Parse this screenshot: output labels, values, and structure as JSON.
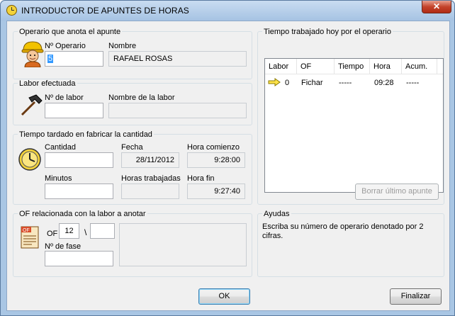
{
  "window": {
    "title": "INTRODUCTOR DE APUNTES DE HORAS",
    "close_glyph": "✕"
  },
  "operario": {
    "legend": "Operario que anota el apunte",
    "num_label": "Nº Operario",
    "num_value": "5",
    "nombre_label": "Nombre",
    "nombre_value": "RAFAEL ROSAS"
  },
  "labor": {
    "legend": "Labor efectuada",
    "num_label": "Nº de labor",
    "num_value": "",
    "nombre_label": "Nombre de la labor",
    "nombre_value": ""
  },
  "tiempo": {
    "legend": "Tiempo tardado en fabricar la cantidad",
    "cantidad_label": "Cantidad",
    "cantidad_value": "",
    "fecha_label": "Fecha",
    "fecha_value": "28/11/2012",
    "hora_comienzo_label": "Hora comienzo",
    "hora_comienzo_value": "9:28:00",
    "minutos_label": "Minutos",
    "minutos_value": "",
    "horas_trab_label": "Horas trabajadas",
    "horas_trab_value": "",
    "hora_fin_label": "Hora fin",
    "hora_fin_value": "9:27:40"
  },
  "of": {
    "legend": "OF relacionada con la labor a anotar",
    "of_label": "OF",
    "of_value": "12",
    "separator": "\\",
    "of_value2": "",
    "fase_label": "Nº de fase",
    "fase_value": "",
    "icon_text": "OF"
  },
  "trabajado": {
    "legend": "Tiempo trabajado hoy por el operario",
    "columns": [
      "Labor",
      "OF",
      "Tiempo",
      "Hora",
      "Acum."
    ],
    "rows": [
      {
        "labor": "0",
        "of": "Fichar",
        "tiempo": "-----",
        "hora": "09:28",
        "acum": "-----"
      }
    ],
    "borrar_label": "Borrar último apunte"
  },
  "ayudas": {
    "legend": "Ayudas",
    "text": "Escriba su número de operario denotado por 2 cifras."
  },
  "buttons": {
    "ok": "OK",
    "finalizar": "Finalizar"
  },
  "colors": {
    "accent": "#3399ff",
    "title_bg": "#a9c6e4",
    "close_red": "#c4442c"
  }
}
